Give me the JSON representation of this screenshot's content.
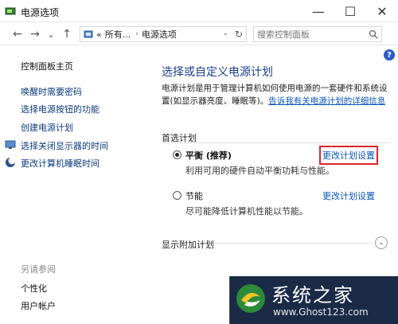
{
  "window": {
    "title": "电源选项",
    "minimize": "—",
    "maximize": "☐",
    "close": "✕"
  },
  "nav": {
    "back": "←",
    "forward": "→",
    "recent": "⌄",
    "up": "↑",
    "breadcrumb": [
      "«",
      "所有...",
      "电源选项"
    ],
    "search_placeholder": "搜索控制面板"
  },
  "help": "?",
  "sidebar": {
    "home": "控制面板主页",
    "items": [
      "唤醒时需要密码",
      "选择电源按钮的功能",
      "创建电源计划",
      "选择关闭显示器的时间",
      "更改计算机睡眠时间"
    ],
    "see_also_label": "另请参阅",
    "see_also": [
      "个性化",
      "用户帐户"
    ]
  },
  "main": {
    "title": "选择或自定义电源计划",
    "desc_text": "电源计划是用于管理计算机如何使用电源的一套硬件和系统设置(如显示器亮度、睡眠等)。",
    "desc_link": "告诉我有关电源计划的详细信息",
    "section_label": "首选计划",
    "plans": [
      {
        "name": "平衡 (推荐)",
        "desc": "利用可用的硬件自动平衡功耗与性能。",
        "link": "更改计划设置",
        "selected": true
      },
      {
        "name": "节能",
        "desc": "尽可能降低计算机性能以节能。",
        "link": "更改计划设置",
        "selected": false
      }
    ],
    "more_plans": "显示附加计划",
    "expand": "⌄"
  },
  "watermark": {
    "title": "系统之家",
    "url": "www.Ghost123.com"
  },
  "colors": {
    "link": "#0a55b6",
    "title": "#1a3e8c",
    "highlight": "#d9262c"
  }
}
